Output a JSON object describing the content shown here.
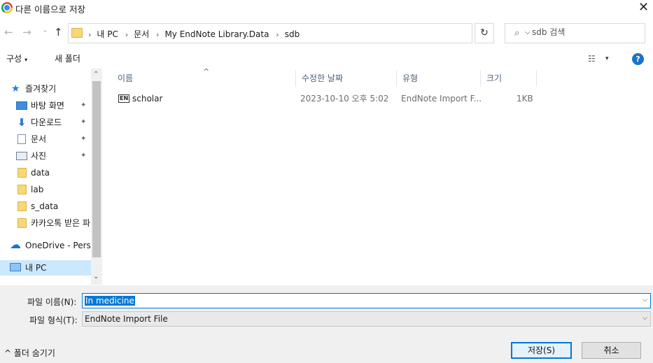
{
  "window": {
    "title": "다른 이름으로 저장",
    "close_glyph": "✕"
  },
  "nav": {
    "back": "←",
    "forward": "→",
    "recent": "⌄",
    "up": "↑",
    "breadcrumbs": [
      "내 PC",
      "문서",
      "My EndNote Library.Data",
      "sdb"
    ],
    "breadcrumb_sep": "›",
    "dropdown": "⌵",
    "refresh": "↻",
    "search_placeholder": "sdb 검색"
  },
  "toolbar": {
    "organize": "구성",
    "organize_arrow": "▾",
    "new_folder": "새 폴더",
    "view_icon": "☷",
    "view_arrow": "▾",
    "help": "?"
  },
  "sidebar": {
    "items": [
      {
        "label": "즐겨찾기",
        "icon": "star-icon"
      },
      {
        "label": "바탕 화면",
        "icon": "desktop-icon",
        "pinned": true
      },
      {
        "label": "다운로드",
        "icon": "download-icon",
        "pinned": true
      },
      {
        "label": "문서",
        "icon": "documents-icon",
        "pinned": true
      },
      {
        "label": "사진",
        "icon": "pictures-icon",
        "pinned": true
      },
      {
        "label": "data",
        "icon": "folder-icon"
      },
      {
        "label": "lab",
        "icon": "folder-icon"
      },
      {
        "label": "s_data",
        "icon": "folder-icon"
      },
      {
        "label": "카카오톡 받은 파",
        "icon": "folder-icon"
      },
      {
        "label": "OneDrive - Personal",
        "icon": "cloud-icon"
      },
      {
        "label": "내 PC",
        "icon": "pc-icon",
        "selected": true
      }
    ],
    "pin_glyph": "📌",
    "scroll_up": "⌃",
    "scroll_down": "⌄"
  },
  "columns": {
    "name": "이름",
    "modified": "수정한 날짜",
    "type": "유형",
    "size": "크기",
    "sort_glyph": "^"
  },
  "files": [
    {
      "icon_text": "EN",
      "name": "scholar",
      "modified": "2023-10-10 오후 5:02",
      "type": "EndNote Import F...",
      "size": "1KB"
    }
  ],
  "form": {
    "filename_label": "파일 이름(N):",
    "filename_value": "In medicine",
    "filetype_label": "파일 형식(T):",
    "filetype_value": "EndNote Import File",
    "dd_glyph": "⌵"
  },
  "footer": {
    "hide_folders": "^ 폴더 숨기기",
    "save": "저장(S)",
    "cancel": "취소"
  }
}
